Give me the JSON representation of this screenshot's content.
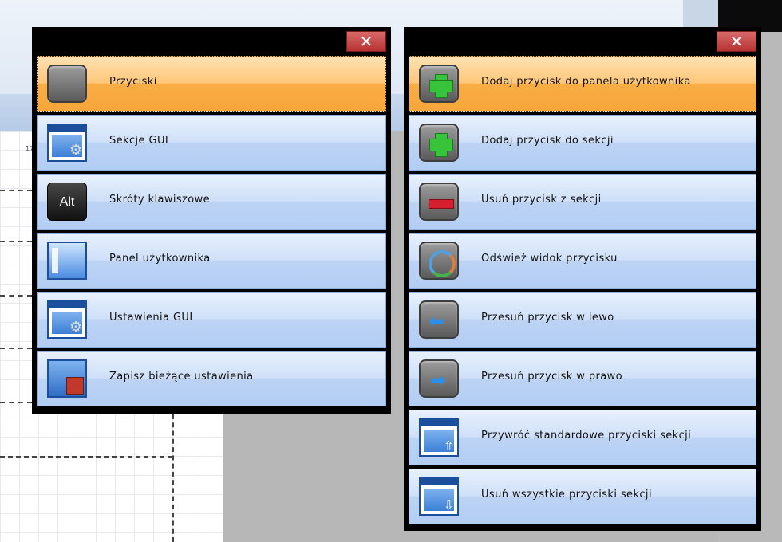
{
  "left_panel": {
    "close_label": "✕",
    "items": [
      {
        "label": "Przyciski",
        "icon": "gray-button-icon",
        "selected": true
      },
      {
        "label": "Sekcje GUI",
        "icon": "gui-section-window-icon",
        "selected": false
      },
      {
        "label": "Skróty klawiszowe",
        "icon": "alt-key-icon",
        "selected": false
      },
      {
        "label": "Panel użytkownika",
        "icon": "user-panel-icon",
        "selected": false
      },
      {
        "label": "Ustawienia GUI",
        "icon": "gui-settings-gear-icon",
        "selected": false
      },
      {
        "label": "Zapisz bieżące ustawienia",
        "icon": "save-disk-icon",
        "selected": false
      }
    ],
    "alt_key_text": "Alt"
  },
  "right_panel": {
    "close_label": "✕",
    "items": [
      {
        "label": "Dodaj przycisk do panela użytkownika",
        "icon": "plus-icon",
        "selected": true
      },
      {
        "label": "Dodaj przycisk do sekcji",
        "icon": "plus-icon",
        "selected": false
      },
      {
        "label": "Usuń przycisk z sekcji",
        "icon": "minus-icon",
        "selected": false
      },
      {
        "label": "Odśwież widok przycisku",
        "icon": "refresh-icon",
        "selected": false
      },
      {
        "label": "Przesuń przycisk w  lewo",
        "icon": "arrow-left-icon",
        "selected": false
      },
      {
        "label": "Przesuń przycisk w  prawo",
        "icon": "arrow-right-icon",
        "selected": false
      },
      {
        "label": "Przywróć standardowe przyciski sekcji",
        "icon": "restore-window-icon",
        "selected": false
      },
      {
        "label": "Usuń wszystkie przyciski sekcji",
        "icon": "remove-all-window-icon",
        "selected": false
      }
    ]
  },
  "background": {
    "ruler_number": "17"
  },
  "colors": {
    "item_gradient_top": "#e8f1fd",
    "item_gradient_bottom": "#b3cdf3",
    "selected_gradient_top": "#ffe2b3",
    "selected_gradient_bottom": "#f7a63a",
    "close_button": "#c64444",
    "panel_frame": "#000000"
  }
}
